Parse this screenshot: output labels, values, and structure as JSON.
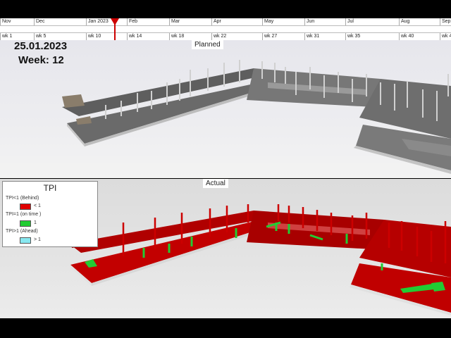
{
  "timeline": {
    "months": [
      "Nov",
      "Dec",
      "Jan 2023",
      "Feb",
      "Mar",
      "Apr",
      "May",
      "Jun",
      "Jul",
      "Aug",
      "Sep"
    ],
    "weeks": [
      "wk 1",
      "wk 5",
      "wk 10",
      "wk 14",
      "wk 18",
      "wk 22",
      "wk 27",
      "wk 31",
      "wk 35",
      "wk 40",
      "wk 4"
    ]
  },
  "status": {
    "date": "25.01.2023",
    "week": "Week: 12"
  },
  "views": {
    "planned_label": "Planned",
    "actual_label": "Actual"
  },
  "legend": {
    "title": "TPI",
    "items": [
      {
        "category": "TPI<1 (Behind)",
        "value": "< 1",
        "color": "#e00000"
      },
      {
        "category": "TPI=1 (on time )",
        "value": "1",
        "color": "#22cc33"
      },
      {
        "category": "TPI>1 (Ahead)",
        "value": "> 1",
        "color": "#88e8f0"
      }
    ]
  },
  "colors": {
    "planned_slab": "#5a5a5a",
    "planned_edge": "#b8b8b8",
    "actual_slab": "#b80000",
    "actual_edge": "#e6e6e6",
    "on_time": "#22cc33",
    "current_date_marker": "#c00000"
  }
}
